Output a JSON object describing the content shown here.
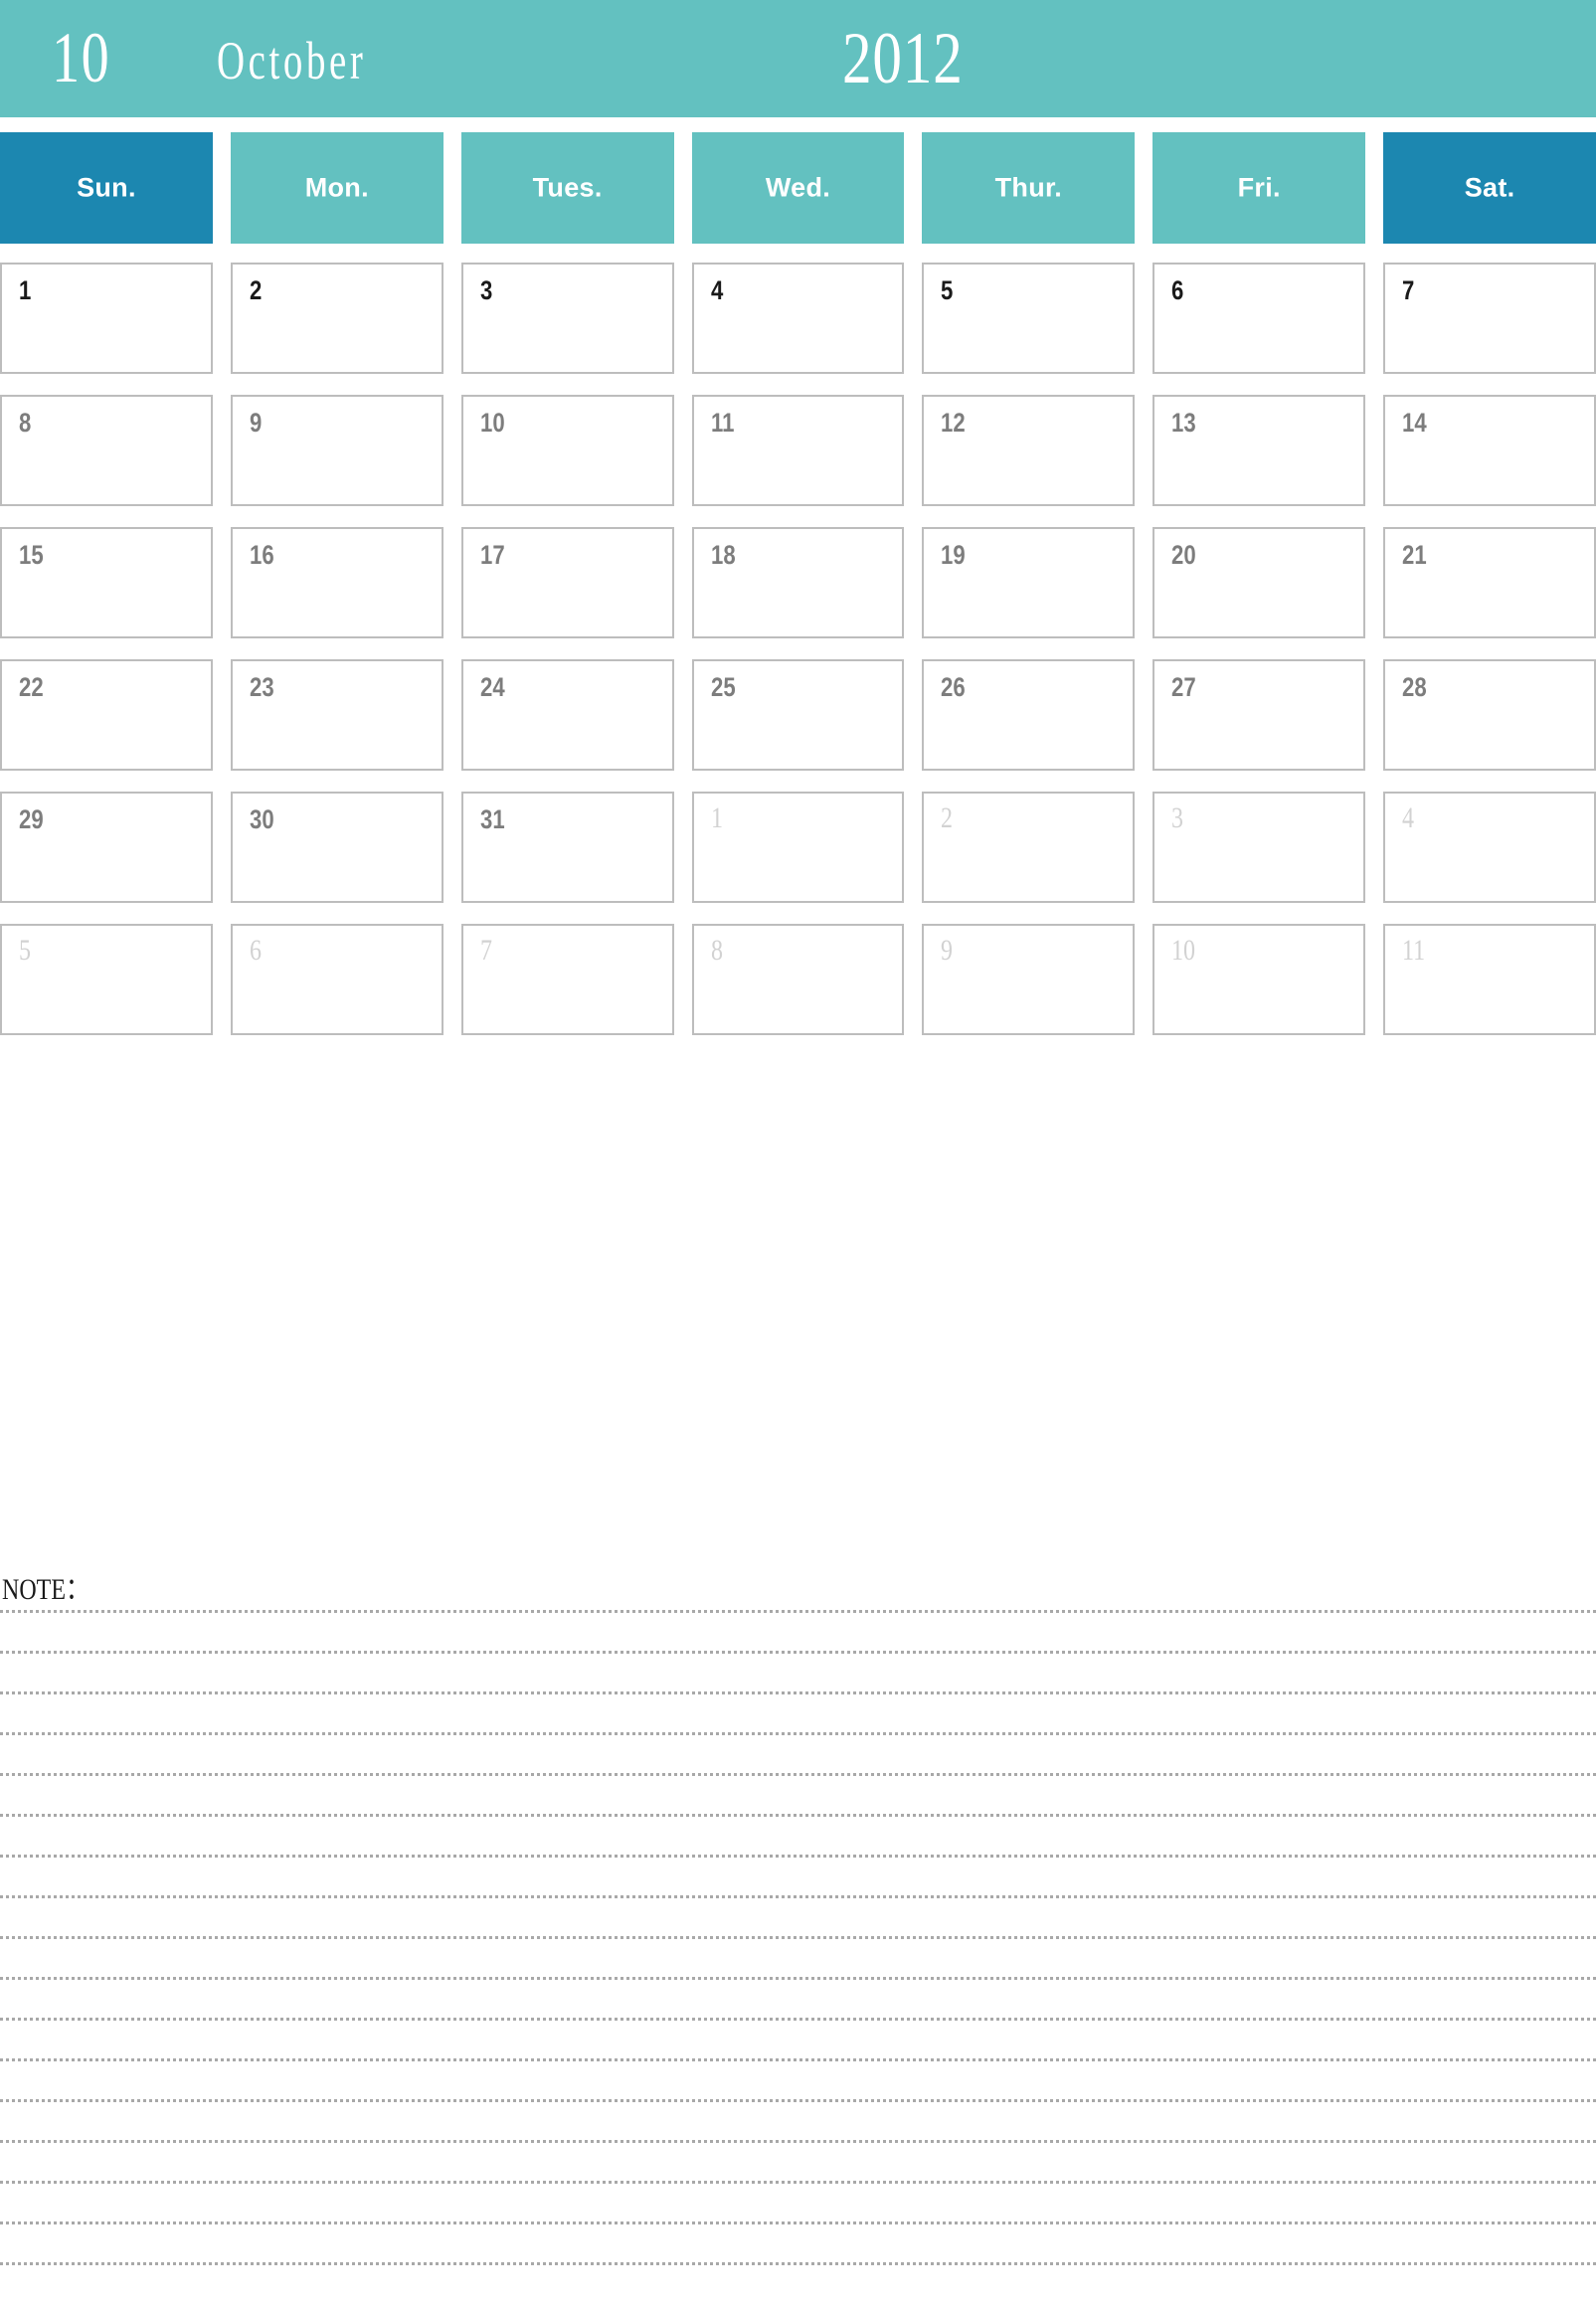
{
  "banner": {
    "month_number": "10",
    "month_name": "October",
    "year": "2012",
    "bg_color": "#63c1c0",
    "text_color": "#ffffff"
  },
  "weekdays": [
    {
      "label": "Sun.",
      "accent": true,
      "color": "#1c87b0"
    },
    {
      "label": "Mon.",
      "accent": false,
      "color": "#63c1c0"
    },
    {
      "label": "Tues.",
      "accent": false,
      "color": "#63c1c0"
    },
    {
      "label": "Wed.",
      "accent": false,
      "color": "#63c1c0"
    },
    {
      "label": "Thur.",
      "accent": false,
      "color": "#63c1c0"
    },
    {
      "label": "Fri.",
      "accent": false,
      "color": "#63c1c0"
    },
    {
      "label": "Sat.",
      "accent": true,
      "color": "#1c87b0"
    }
  ],
  "weeks": [
    [
      {
        "day": "1",
        "style": "current"
      },
      {
        "day": "2",
        "style": "current"
      },
      {
        "day": "3",
        "style": "current"
      },
      {
        "day": "4",
        "style": "current"
      },
      {
        "day": "5",
        "style": "current"
      },
      {
        "day": "6",
        "style": "current"
      },
      {
        "day": "7",
        "style": "current"
      }
    ],
    [
      {
        "day": "8",
        "style": "mid"
      },
      {
        "day": "9",
        "style": "mid"
      },
      {
        "day": "10",
        "style": "mid"
      },
      {
        "day": "11",
        "style": "mid"
      },
      {
        "day": "12",
        "style": "mid"
      },
      {
        "day": "13",
        "style": "mid"
      },
      {
        "day": "14",
        "style": "mid"
      }
    ],
    [
      {
        "day": "15",
        "style": "mid"
      },
      {
        "day": "16",
        "style": "mid"
      },
      {
        "day": "17",
        "style": "mid"
      },
      {
        "day": "18",
        "style": "mid"
      },
      {
        "day": "19",
        "style": "mid"
      },
      {
        "day": "20",
        "style": "mid"
      },
      {
        "day": "21",
        "style": "mid"
      }
    ],
    [
      {
        "day": "22",
        "style": "mid"
      },
      {
        "day": "23",
        "style": "mid"
      },
      {
        "day": "24",
        "style": "mid"
      },
      {
        "day": "25",
        "style": "mid"
      },
      {
        "day": "26",
        "style": "mid"
      },
      {
        "day": "27",
        "style": "mid"
      },
      {
        "day": "28",
        "style": "mid"
      }
    ],
    [
      {
        "day": "29",
        "style": "mid"
      },
      {
        "day": "30",
        "style": "mid"
      },
      {
        "day": "31",
        "style": "mid"
      },
      {
        "day": "1",
        "style": "other"
      },
      {
        "day": "2",
        "style": "other"
      },
      {
        "day": "3",
        "style": "other"
      },
      {
        "day": "4",
        "style": "other"
      }
    ],
    [
      {
        "day": "5",
        "style": "other"
      },
      {
        "day": "6",
        "style": "other"
      },
      {
        "day": "7",
        "style": "other"
      },
      {
        "day": "8",
        "style": "other"
      },
      {
        "day": "9",
        "style": "other"
      },
      {
        "day": "10",
        "style": "other"
      },
      {
        "day": "11",
        "style": "other"
      }
    ]
  ],
  "note": {
    "label": "NOTE：",
    "line_count": 17,
    "line_color": "#a8a8a8"
  }
}
